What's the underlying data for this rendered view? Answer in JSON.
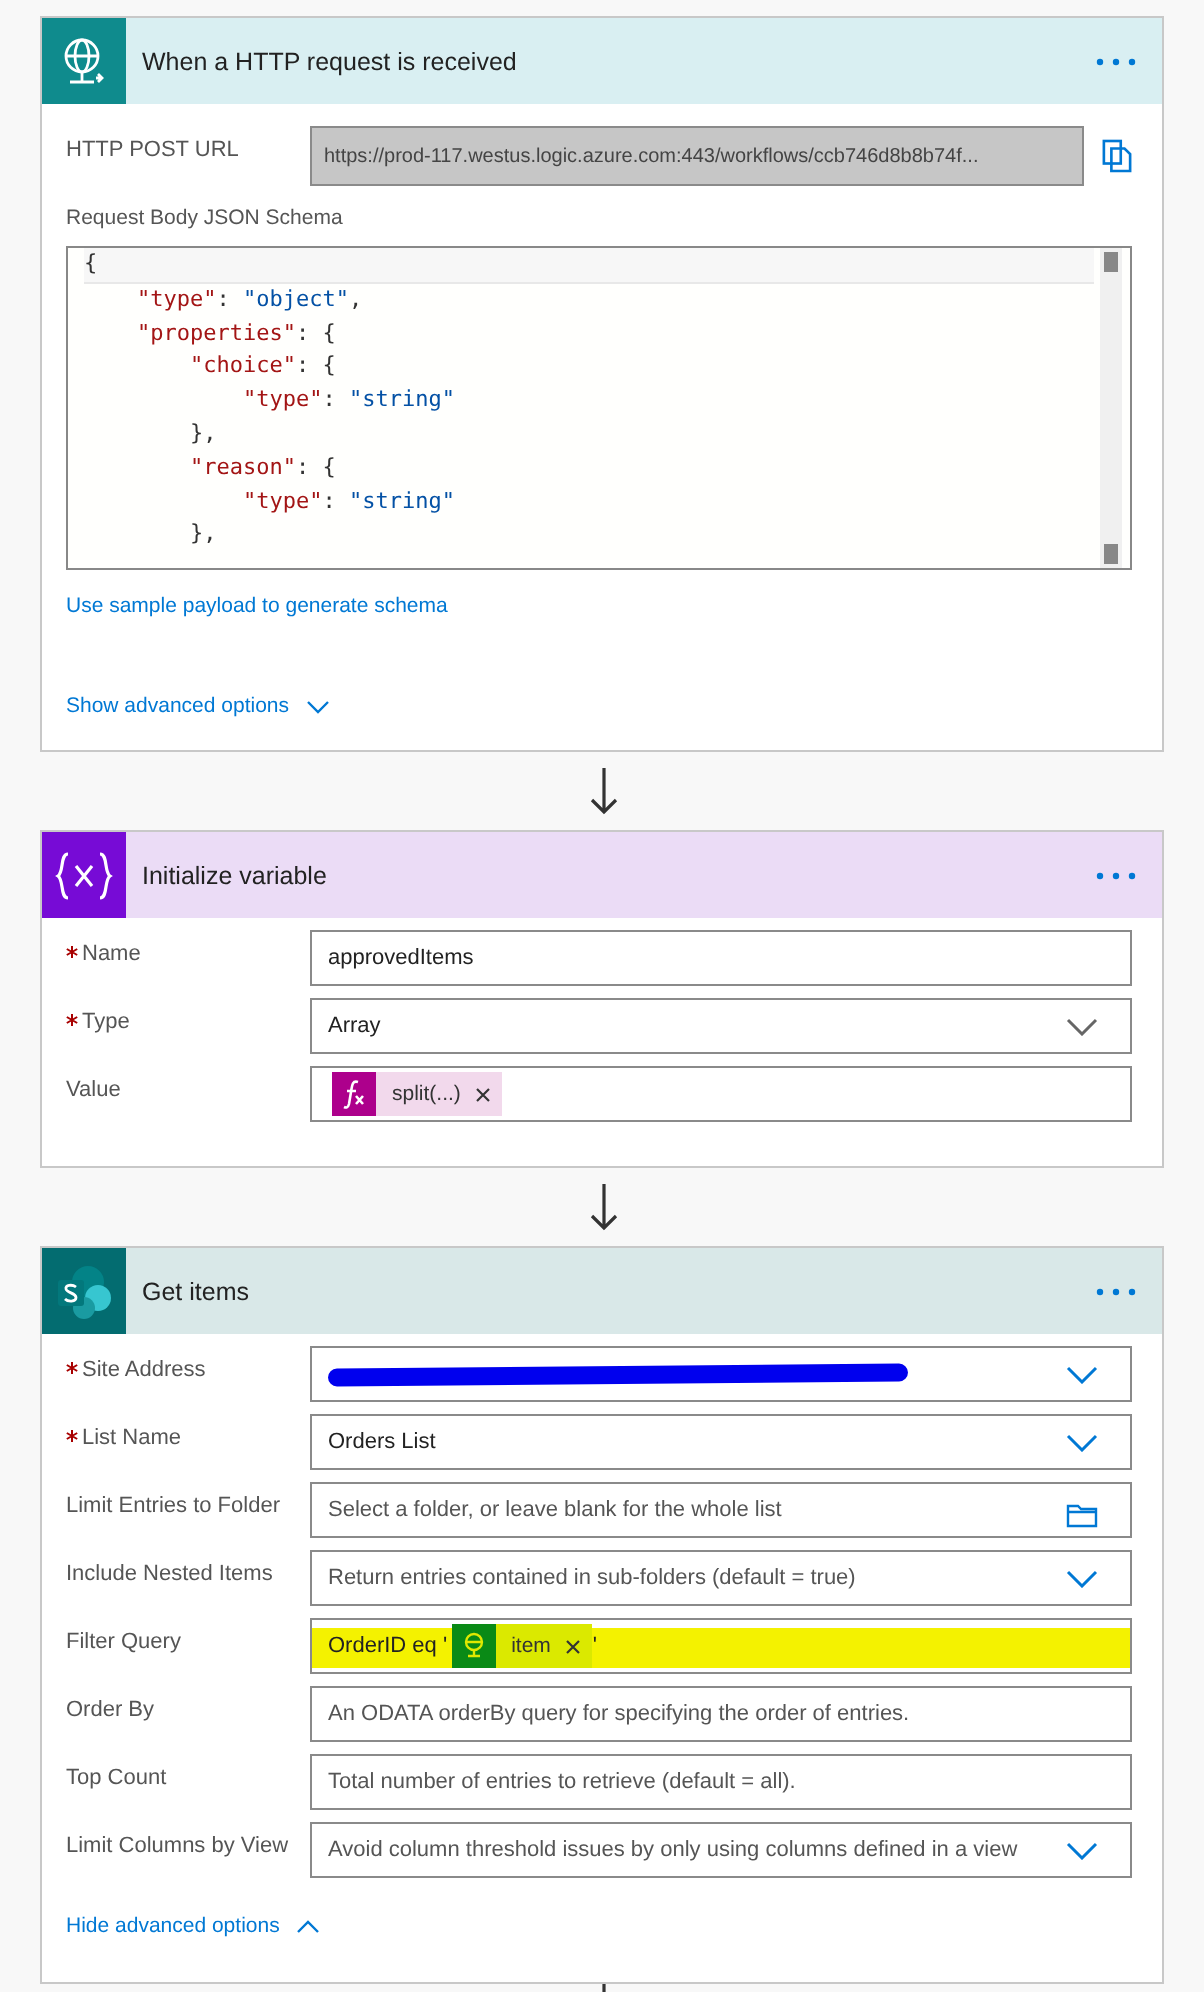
{
  "cards": [
    {
      "kind": "http",
      "title": "When a HTTP request is received",
      "fields": [
        {
          "kind": "url",
          "label": "HTTP POST URL",
          "required": false,
          "value": "https://prod-117.westus.logic.azure.com:443/workflows/ccb746d8b8b74f..."
        },
        {
          "kind": "code",
          "label": "Request Body JSON Schema",
          "required": false,
          "lines": [
            [
              {
                "kind": "punct",
                "text": "{"
              }
            ],
            [
              {
                "kind": "key",
                "text": "    \"type\""
              },
              {
                "kind": "punct",
                "text": ": "
              },
              {
                "kind": "string",
                "text": "\"object\""
              },
              {
                "kind": "punct",
                "text": ","
              }
            ],
            [
              {
                "kind": "key",
                "text": "    \"properties\""
              },
              {
                "kind": "punct",
                "text": ": {"
              }
            ],
            [
              {
                "kind": "key",
                "text": "        \"choice\""
              },
              {
                "kind": "punct",
                "text": ": {"
              }
            ],
            [
              {
                "kind": "key",
                "text": "            \"type\""
              },
              {
                "kind": "punct",
                "text": ": "
              },
              {
                "kind": "string",
                "text": "\"string\""
              }
            ],
            [
              {
                "kind": "punct",
                "text": "        },"
              }
            ],
            [
              {
                "kind": "key",
                "text": "        \"reason\""
              },
              {
                "kind": "punct",
                "text": ": {"
              }
            ],
            [
              {
                "kind": "key",
                "text": "            \"type\""
              },
              {
                "kind": "punct",
                "text": ": "
              },
              {
                "kind": "string",
                "text": "\"string\""
              }
            ],
            [
              {
                "kind": "punct",
                "text": "        },"
              }
            ]
          ],
          "link": "Use sample payload to generate schema"
        }
      ],
      "toggle": {
        "label": "Show advanced options",
        "expanded": false
      }
    },
    {
      "kind": "variable",
      "title": "Initialize variable",
      "fields": [
        {
          "kind": "text",
          "label": "Name",
          "required": true,
          "value": "approvedItems"
        },
        {
          "kind": "dropdown",
          "label": "Type",
          "required": true,
          "value": "Array"
        },
        {
          "kind": "expression",
          "label": "Value",
          "required": false,
          "tokens": [
            {
              "kind": "expression",
              "text": "split(...)"
            }
          ]
        }
      ]
    },
    {
      "kind": "sharepoint",
      "title": "Get items",
      "fields": [
        {
          "kind": "dropdown",
          "label": "Site Address",
          "required": true,
          "redacted": true
        },
        {
          "kind": "dropdown",
          "label": "List Name",
          "required": true,
          "value": "Orders List"
        },
        {
          "kind": "folder",
          "label": "Limit Entries to Folder",
          "required": false,
          "placeholder": "Select a folder, or leave blank for the whole list"
        },
        {
          "kind": "dropdown",
          "label": "Include Nested Items",
          "required": false,
          "placeholder": "Return entries contained in sub-folders (default = true)"
        },
        {
          "kind": "expression",
          "label": "Filter Query",
          "required": false,
          "highlighted": true,
          "tokens": [
            {
              "kind": "text",
              "text": "OrderID eq '"
            },
            {
              "kind": "dynamic",
              "text": "item"
            },
            {
              "kind": "text",
              "text": "'"
            }
          ]
        },
        {
          "kind": "text",
          "label": "Order By",
          "required": false,
          "placeholder": "An ODATA orderBy query for specifying the order of entries."
        },
        {
          "kind": "text",
          "label": "Top Count",
          "required": false,
          "placeholder": "Total number of entries to retrieve (default = all)."
        },
        {
          "kind": "dropdown",
          "label": "Limit Columns by View",
          "required": false,
          "placeholder": "Avoid column threshold issues by only using columns defined in a view"
        }
      ],
      "toggle": {
        "label": "Hide advanced options",
        "expanded": true
      }
    }
  ]
}
